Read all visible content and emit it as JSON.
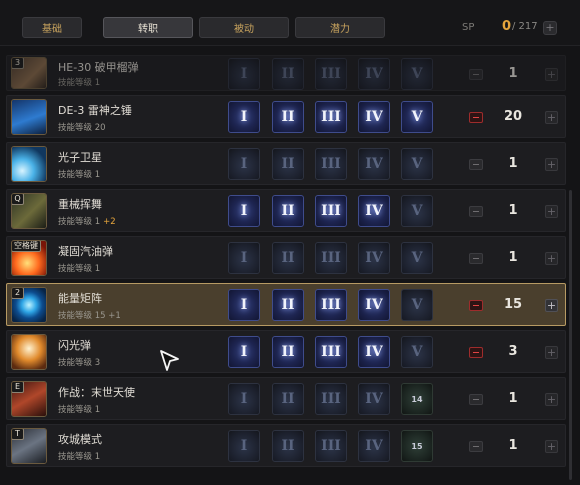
{
  "tabs": [
    {
      "label": "基础",
      "active": false
    },
    {
      "label": "转职",
      "active": true
    },
    {
      "label": "被动",
      "active": false
    },
    {
      "label": "潜力",
      "active": false
    }
  ],
  "sp": {
    "label": "SP",
    "current": "0",
    "total": "/ 217",
    "plus": "+"
  },
  "skills": [
    {
      "hotkey": "3",
      "name": "HE-30 破甲榴弹",
      "level_text": "技能等级 1",
      "bonus": "",
      "tiers": [
        "I",
        "II",
        "III",
        "IV",
        "V"
      ],
      "tiers_on": [
        false,
        false,
        false,
        false,
        false
      ],
      "value": "1",
      "icon": "grenade-icon",
      "dim": true
    },
    {
      "hotkey": "",
      "name": "DE-3 雷神之锤",
      "level_text": "技能等级 20",
      "bonus": "",
      "tiers": [
        "I",
        "II",
        "III",
        "IV",
        "V"
      ],
      "tiers_on": [
        true,
        true,
        true,
        true,
        true
      ],
      "value": "20",
      "icon": "thor-hammer-icon",
      "dim": false
    },
    {
      "hotkey": "",
      "name": "光子卫星",
      "level_text": "技能等级 1",
      "bonus": "",
      "tiers": [
        "I",
        "II",
        "III",
        "IV",
        "V"
      ],
      "tiers_on": [
        false,
        false,
        false,
        false,
        false
      ],
      "value": "1",
      "icon": "satellite-icon",
      "dim": false
    },
    {
      "hotkey": "Q",
      "name": "重械挥舞",
      "level_text": "技能等级 1",
      "bonus": "+2",
      "tiers": [
        "I",
        "II",
        "III",
        "IV",
        "V"
      ],
      "tiers_on": [
        true,
        true,
        true,
        true,
        false
      ],
      "value": "1",
      "icon": "heavy-weapon-icon",
      "dim": false
    },
    {
      "hotkey": "空格键",
      "name": "凝固汽油弹",
      "level_text": "技能等级 1",
      "bonus": "",
      "tiers": [
        "I",
        "II",
        "III",
        "IV",
        "V"
      ],
      "tiers_on": [
        false,
        false,
        false,
        false,
        false
      ],
      "value": "1",
      "icon": "napalm-icon",
      "dim": false
    },
    {
      "hotkey": "2",
      "name": "能量矩阵",
      "level_text": "技能等级 15 +1",
      "bonus": "",
      "tiers": [
        "I",
        "II",
        "III",
        "IV",
        "V"
      ],
      "tiers_on": [
        true,
        true,
        true,
        true,
        false
      ],
      "value": "15",
      "icon": "energy-matrix-icon",
      "dim": false,
      "selected": true
    },
    {
      "hotkey": "",
      "name": "闪光弹",
      "level_text": "技能等级 3",
      "bonus": "",
      "tiers": [
        "I",
        "II",
        "III",
        "IV",
        "V"
      ],
      "tiers_on": [
        true,
        true,
        true,
        true,
        false
      ],
      "value": "3",
      "icon": "flashbang-icon",
      "dim": false
    },
    {
      "hotkey": "E",
      "name": "作战：末世天使",
      "level_text": "技能等级 1",
      "bonus": "",
      "tiers": [
        "I",
        "II",
        "III",
        "IV",
        "14"
      ],
      "tiers_on": [
        false,
        false,
        false,
        false,
        false
      ],
      "value": "1",
      "icon": "apocalypse-angel-icon",
      "dim": false
    },
    {
      "hotkey": "T",
      "name": "攻城模式",
      "level_text": "技能等级 1",
      "bonus": "",
      "tiers": [
        "I",
        "II",
        "III",
        "IV",
        "15"
      ],
      "tiers_on": [
        false,
        false,
        false,
        false,
        false
      ],
      "value": "1",
      "icon": "siege-mode-icon",
      "dim": false
    }
  ],
  "colors": {
    "accent": "#e6a53c",
    "tab_text": "#c9a45e",
    "tier_on": "#33407c",
    "minus_active": "#e04444"
  }
}
